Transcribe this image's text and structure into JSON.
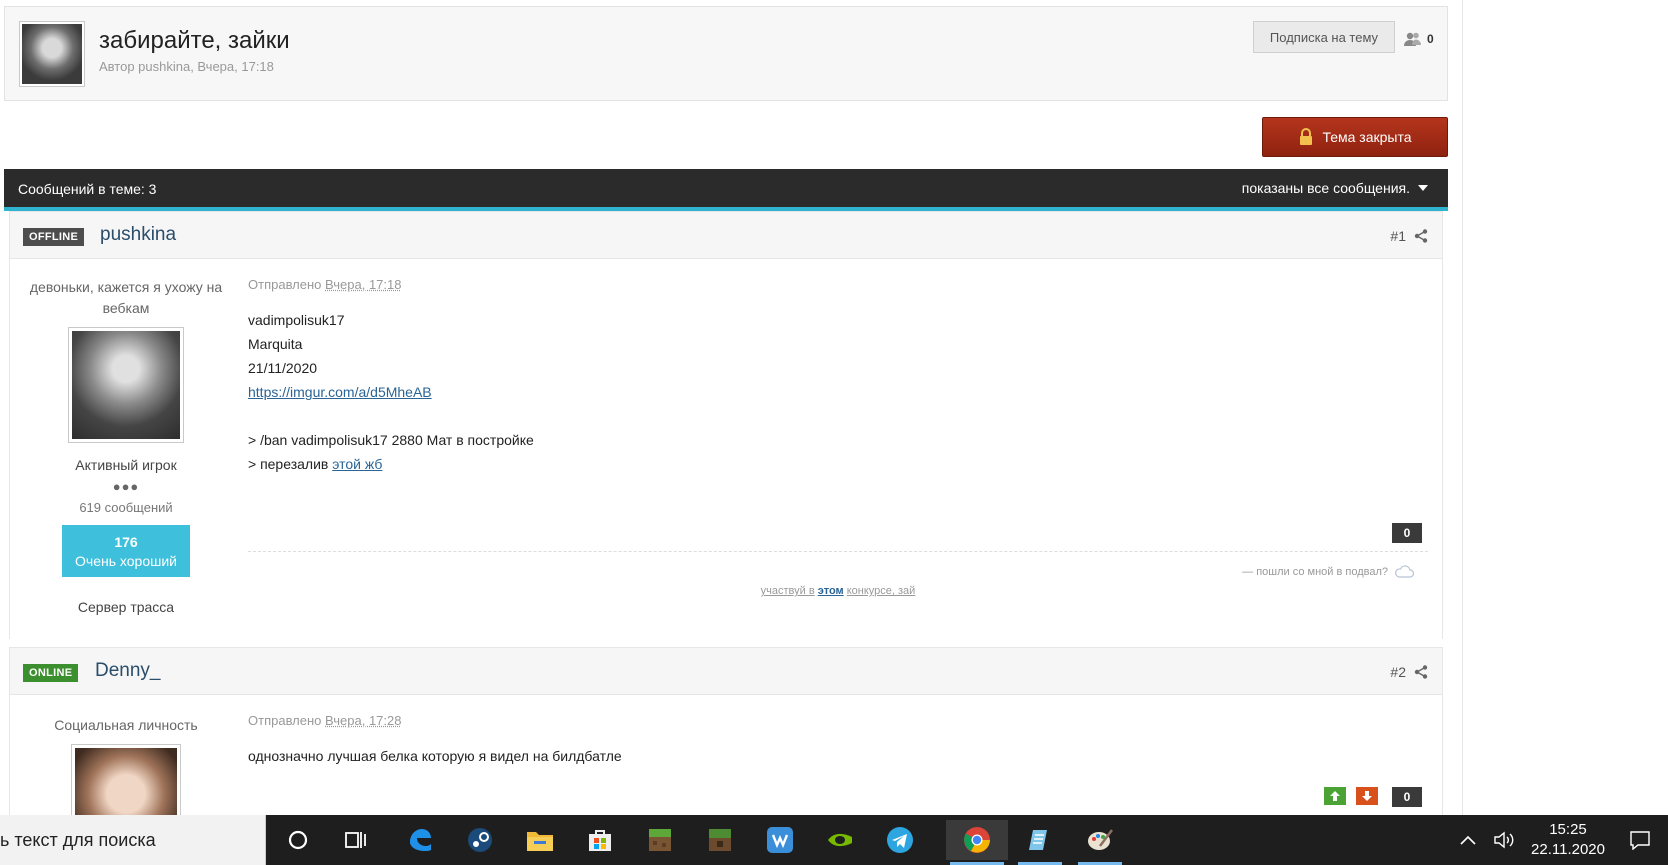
{
  "topic": {
    "title": "забирайте, зайки",
    "meta": "Автор pushkina, Вчера, 17:18",
    "subscribe_label": "Подписка на тему",
    "followers_count": "0",
    "locked_label": "Тема закрыта"
  },
  "bar": {
    "messages_count": "Сообщений в теме: 3",
    "shown_label": "показаны все сообщения."
  },
  "posts": [
    {
      "status": "OFFLINE",
      "author": "pushkina",
      "number": "#1",
      "user_title": "девоньки, кажется я ухожу на вебкам",
      "group": "Активный игрок",
      "pips": "●●●",
      "post_count": "619 сообщений",
      "reputation": "176",
      "reputation_label": "Очень хороший",
      "server": "Сервер трасса",
      "posted_prefix": "Отправлено",
      "posted_date": "Вчера, 17:18",
      "lines": [
        "vadimpolisuk17",
        "Marquita",
        "21/11/2020"
      ],
      "link": "https://imgur.com/a/d5MheAB",
      "line_ban": "> /ban vadimpolisuk17 2880 Мат в постройке",
      "line_reupload_prefix": "> перезалив",
      "line_reupload_link": "этой жб",
      "rep_count": "0",
      "sig_right": "— пошли со мной в подвал?",
      "sig_center_a": "участвуй в",
      "sig_center_link": "этом",
      "sig_center_b": "конкурсе, зай"
    },
    {
      "status": "ONLINE",
      "author": "Denny_",
      "number": "#2",
      "user_title": "Социальная личность",
      "posted_prefix": "Отправлено",
      "posted_date": "Вчера, 17:28",
      "text": "однозначно лучшая белка которую я видел на билдбатле",
      "rep_count": "0"
    }
  ],
  "taskbar": {
    "search_text": "ь текст для поиска",
    "time": "15:25",
    "date": "22.11.2020",
    "apps": [
      "cortana-icon",
      "task-view-icon",
      "edge-icon",
      "steam-icon",
      "file-explorer-icon",
      "store-icon",
      "minecraft-icon",
      "minecraft-dungeons-icon",
      "vk-icon",
      "nvidia-icon",
      "telegram-icon",
      "chrome-icon",
      "notepad-icon",
      "paint-icon"
    ]
  },
  "colors": {
    "accent_bar": "#2fb3cf",
    "locked_red": "#a52c16",
    "reputation_blue": "#3ec0dc",
    "online_green": "#3c8f2e"
  }
}
